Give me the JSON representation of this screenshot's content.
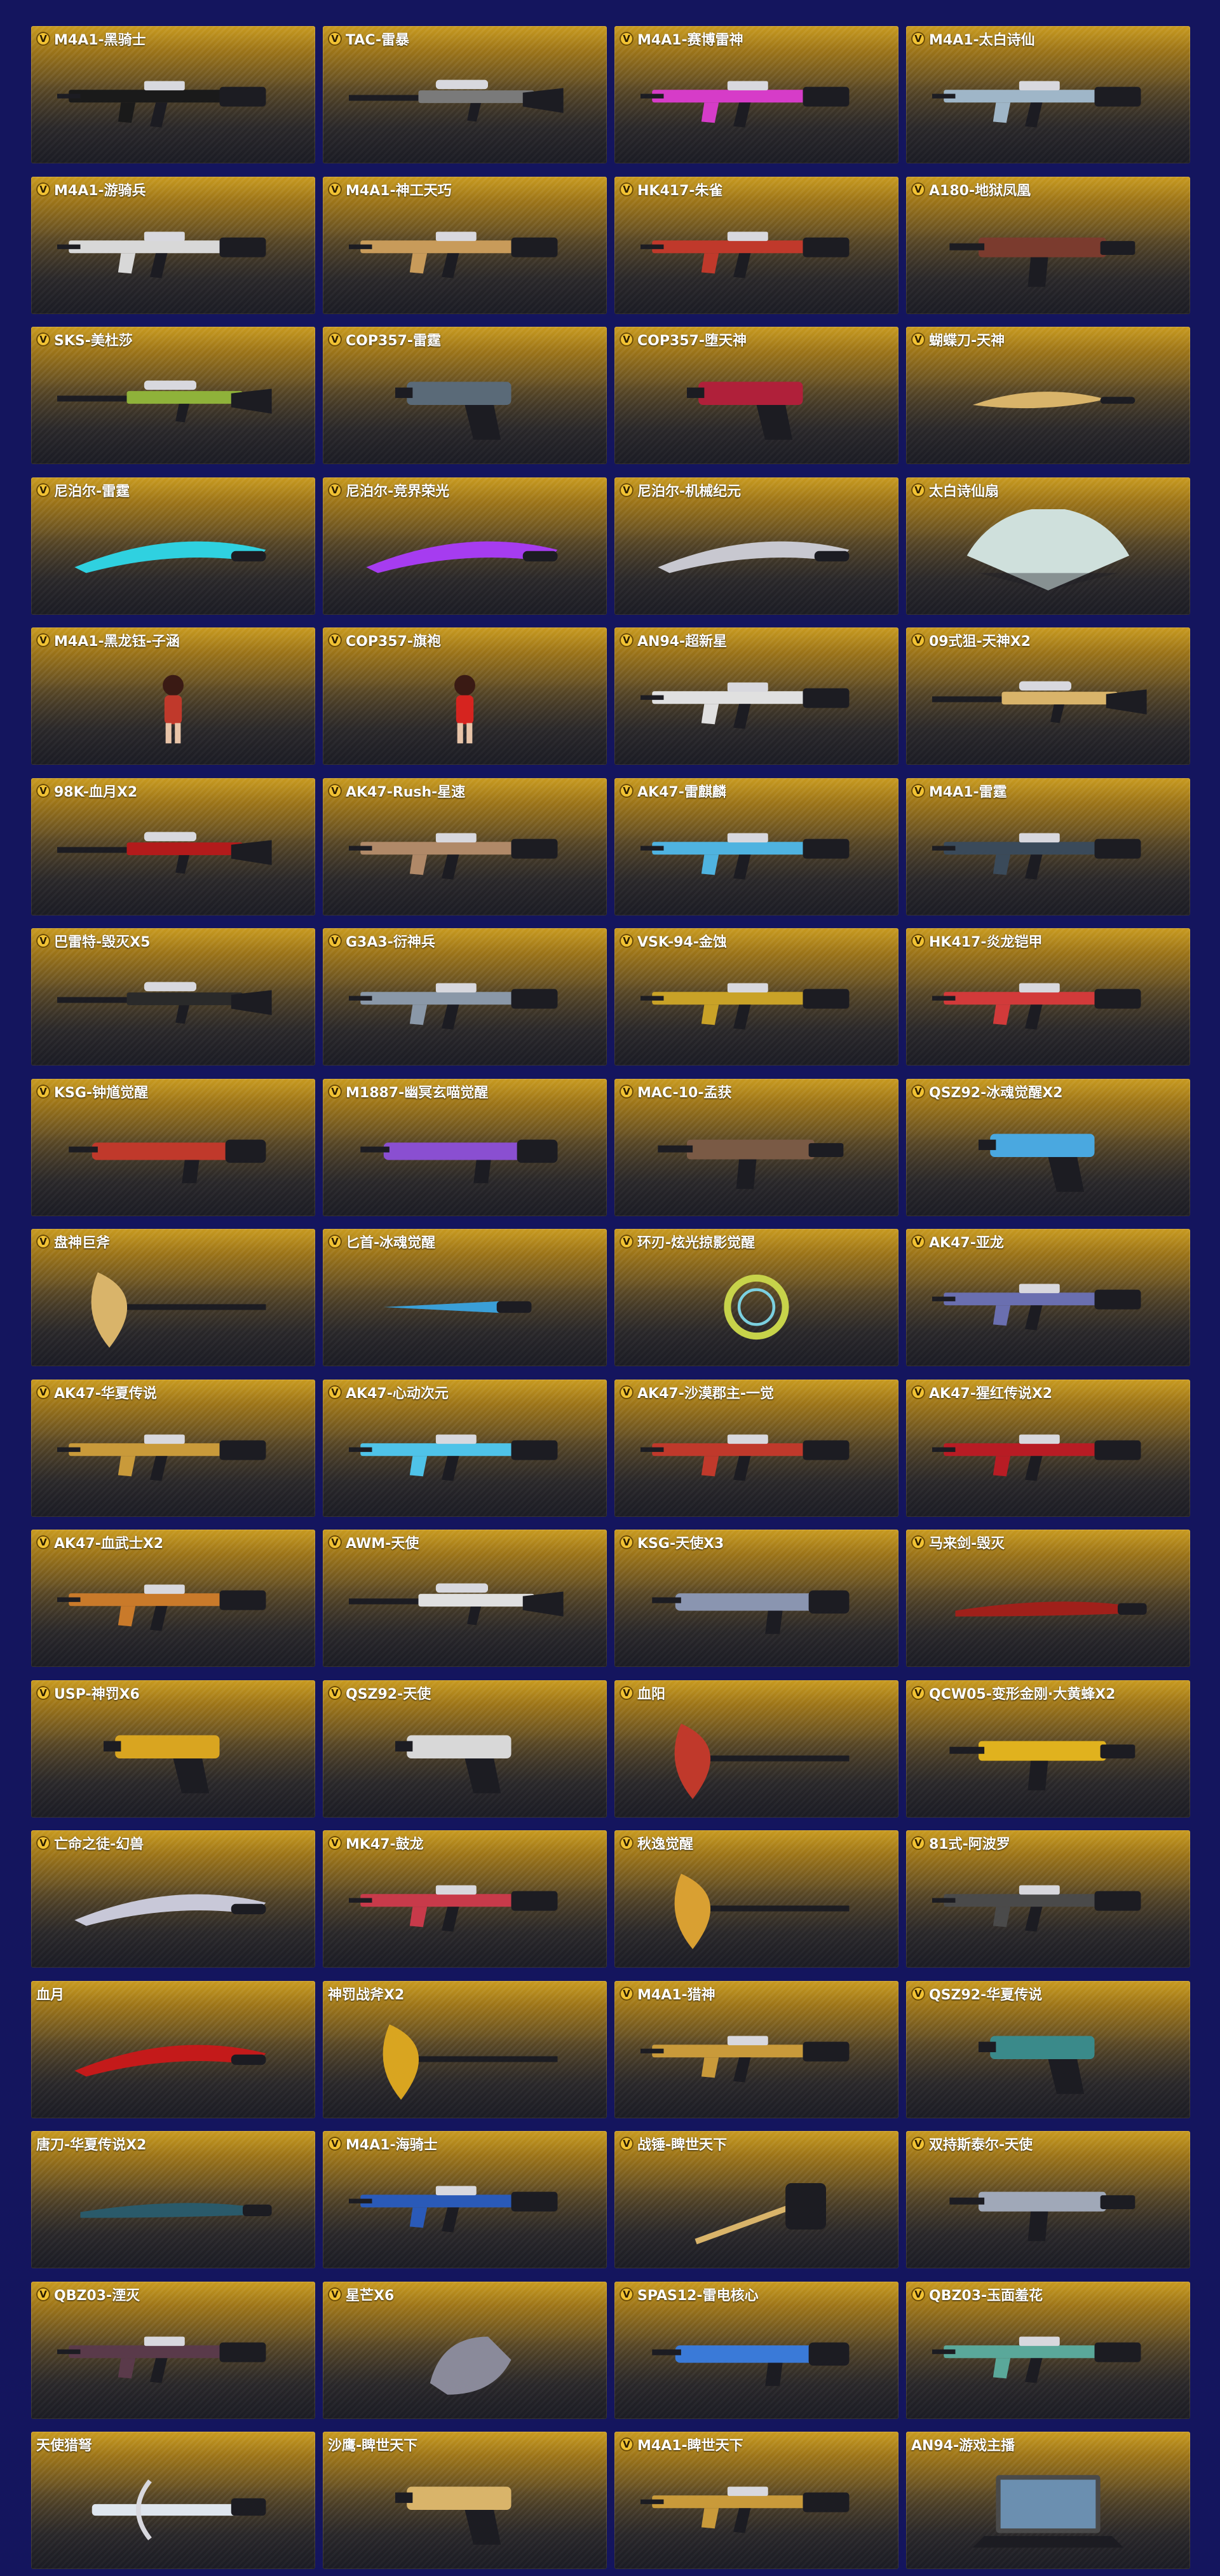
{
  "colors": {
    "background": "#14155e",
    "card_top": "#c89a1f",
    "card_bottom": "#25262e",
    "vip_badge": "#f1c233"
  },
  "items": [
    {
      "title": "M4A1-黑骑士",
      "vip": true,
      "icon": "rifle",
      "accent": "#1a1a1a"
    },
    {
      "title": "TAC-雷暴",
      "vip": true,
      "icon": "sniper",
      "accent": "#7a7a7a"
    },
    {
      "title": "M4A1-赛博雷神",
      "vip": true,
      "icon": "rifle",
      "accent": "#d63cc8"
    },
    {
      "title": "M4A1-太白诗仙",
      "vip": true,
      "icon": "rifle",
      "accent": "#9fb6c8"
    },
    {
      "title": "M4A1-游骑兵",
      "vip": true,
      "icon": "rifle",
      "accent": "#d8d8d8"
    },
    {
      "title": "M4A1-神工天巧",
      "vip": true,
      "icon": "rifle",
      "accent": "#c89b5a"
    },
    {
      "title": "HK417-朱雀",
      "vip": true,
      "icon": "rifle",
      "accent": "#c0392b"
    },
    {
      "title": "A180-地狱凤凰",
      "vip": true,
      "icon": "smg",
      "accent": "#7b3b2e"
    },
    {
      "title": "SKS-美杜莎",
      "vip": true,
      "icon": "sniper",
      "accent": "#8fb23a"
    },
    {
      "title": "COP357-雷霆",
      "vip": true,
      "icon": "pistol",
      "accent": "#5a6a78"
    },
    {
      "title": "COP357-堕天神",
      "vip": true,
      "icon": "pistol",
      "accent": "#b0203a"
    },
    {
      "title": "蝴蝶刀-天神",
      "vip": true,
      "icon": "knife",
      "accent": "#d9b46a"
    },
    {
      "title": "尼泊尔-雷霆",
      "vip": true,
      "icon": "blade",
      "accent": "#2fd1e0"
    },
    {
      "title": "尼泊尔-竞界荣光",
      "vip": true,
      "icon": "blade",
      "accent": "#a63cf0"
    },
    {
      "title": "尼泊尔-机械纪元",
      "vip": true,
      "icon": "blade",
      "accent": "#c8c8d0"
    },
    {
      "title": "太白诗仙扇",
      "vip": true,
      "icon": "fan",
      "accent": "#cfe0dc"
    },
    {
      "title": "M4A1-黑龙钰-子涵",
      "vip": true,
      "icon": "character",
      "accent": "#c0392b"
    },
    {
      "title": "COP357-旗袍",
      "vip": true,
      "icon": "character",
      "accent": "#d6241f"
    },
    {
      "title": "AN94-超新星",
      "vip": true,
      "icon": "rifle",
      "accent": "#e0e0e0"
    },
    {
      "title": "09式狙-天神X2",
      "vip": true,
      "icon": "sniper",
      "accent": "#d9b46a"
    },
    {
      "title": "98K-血月X2",
      "vip": true,
      "icon": "sniper",
      "accent": "#b31b1b"
    },
    {
      "title": "AK47-Rush-星速",
      "vip": true,
      "icon": "rifle",
      "accent": "#b08968"
    },
    {
      "title": "AK47-雷麒麟",
      "vip": true,
      "icon": "rifle",
      "accent": "#4fb3e0"
    },
    {
      "title": "M4A1-雷霆",
      "vip": true,
      "icon": "rifle",
      "accent": "#3a4a5a"
    },
    {
      "title": "巴雷特-毁灭X5",
      "vip": true,
      "icon": "sniper",
      "accent": "#2a2a2a"
    },
    {
      "title": "G3A3-衍神兵",
      "vip": true,
      "icon": "rifle",
      "accent": "#8a98a8"
    },
    {
      "title": "VSK-94-金蚀",
      "vip": true,
      "icon": "rifle",
      "accent": "#c9a227"
    },
    {
      "title": "HK417-炎龙铠甲",
      "vip": true,
      "icon": "rifle",
      "accent": "#d23a3a"
    },
    {
      "title": "KSG-钟馗觉醒",
      "vip": true,
      "icon": "shotgun",
      "accent": "#c0392b"
    },
    {
      "title": "M1887-幽冥玄喵觉醒",
      "vip": true,
      "icon": "shotgun",
      "accent": "#8a4fd1"
    },
    {
      "title": "MAC-10-孟获",
      "vip": true,
      "icon": "smg",
      "accent": "#7a5a45"
    },
    {
      "title": "QSZ92-冰魂觉醒X2",
      "vip": true,
      "icon": "pistol",
      "accent": "#4aa8e0"
    },
    {
      "title": "盘神巨斧",
      "vip": true,
      "icon": "axe",
      "accent": "#d9b46a"
    },
    {
      "title": "匕首-冰魂觉醒",
      "vip": true,
      "icon": "dagger",
      "accent": "#3a9fd8"
    },
    {
      "title": "环刃-炫光掠影觉醒",
      "vip": true,
      "icon": "ring",
      "accent": "#c7d34a"
    },
    {
      "title": "AK47-亚龙",
      "vip": true,
      "icon": "rifle",
      "accent": "#6a6fb0"
    },
    {
      "title": "AK47-华夏传说",
      "vip": true,
      "icon": "rifle",
      "accent": "#c99a3a"
    },
    {
      "title": "AK47-心动次元",
      "vip": true,
      "icon": "rifle",
      "accent": "#4fc3e8"
    },
    {
      "title": "AK47-沙漠郡主-一觉",
      "vip": true,
      "icon": "rifle",
      "accent": "#c0392b"
    },
    {
      "title": "AK47-猩红传说X2",
      "vip": true,
      "icon": "rifle",
      "accent": "#b81c24"
    },
    {
      "title": "AK47-血武士X2",
      "vip": true,
      "icon": "rifle",
      "accent": "#c97a2a"
    },
    {
      "title": "AWM-天使",
      "vip": true,
      "icon": "sniper",
      "accent": "#e0e0e0"
    },
    {
      "title": "KSG-天使X3",
      "vip": true,
      "icon": "shotgun",
      "accent": "#8a95b0"
    },
    {
      "title": "马来剑-毁灭",
      "vip": true,
      "icon": "sword",
      "accent": "#a0201a"
    },
    {
      "title": "USP-神罚X6",
      "vip": true,
      "icon": "pistol",
      "accent": "#d9a520"
    },
    {
      "title": "QSZ92-天使",
      "vip": true,
      "icon": "pistol",
      "accent": "#d8d8d8"
    },
    {
      "title": "血阳",
      "vip": true,
      "icon": "axe",
      "accent": "#c0392b"
    },
    {
      "title": "QCW05-变形金刚·大黄蜂X2",
      "vip": true,
      "icon": "smg",
      "accent": "#e0b21e"
    },
    {
      "title": "亡命之徒-幻兽",
      "vip": true,
      "icon": "blade",
      "accent": "#c8c8d8"
    },
    {
      "title": "MK47-鼓龙",
      "vip": true,
      "icon": "rifle",
      "accent": "#c83a4a"
    },
    {
      "title": "秋逸觉醒",
      "vip": true,
      "icon": "axe",
      "accent": "#d9a032"
    },
    {
      "title": "81式-阿波罗",
      "vip": true,
      "icon": "rifle",
      "accent": "#4a4a4a"
    },
    {
      "title": "血月",
      "vip": false,
      "icon": "blade",
      "accent": "#c41a1a"
    },
    {
      "title": "神罚战斧X2",
      "vip": false,
      "icon": "axe",
      "accent": "#d9a520"
    },
    {
      "title": "M4A1-猎神",
      "vip": true,
      "icon": "rifle",
      "accent": "#c99a3a"
    },
    {
      "title": "QSZ92-华夏传说",
      "vip": true,
      "icon": "pistol",
      "accent": "#3a8a8a"
    },
    {
      "title": "唐刀-华夏传说X2",
      "vip": false,
      "icon": "sword",
      "accent": "#2a5a6a"
    },
    {
      "title": "M4A1-海骑士",
      "vip": true,
      "icon": "rifle",
      "accent": "#2a5ab8"
    },
    {
      "title": "战锤-睥世天下",
      "vip": true,
      "icon": "hammer",
      "accent": "#d9b46a"
    },
    {
      "title": "双持斯泰尔-天使",
      "vip": true,
      "icon": "smg",
      "accent": "#a0a8b8"
    },
    {
      "title": "QBZ03-湮灭",
      "vip": true,
      "icon": "rifle",
      "accent": "#5a3a4a"
    },
    {
      "title": "星芒X6",
      "vip": true,
      "icon": "gauntlet",
      "accent": "#8a8a9a"
    },
    {
      "title": "SPAS12-雷电核心",
      "vip": true,
      "icon": "shotgun",
      "accent": "#3a7ad8"
    },
    {
      "title": "QBZ03-玉面羞花",
      "vip": true,
      "icon": "rifle",
      "accent": "#5aa89a"
    },
    {
      "title": "天使猎弩",
      "vip": false,
      "icon": "crossbow",
      "accent": "#dfe6ee"
    },
    {
      "title": "沙鹰-睥世天下",
      "vip": false,
      "icon": "pistol",
      "accent": "#d9b46a"
    },
    {
      "title": "M4A1-睥世天下",
      "vip": true,
      "icon": "rifle",
      "accent": "#c99a3a"
    },
    {
      "title": "AN94-游戏主播",
      "vip": false,
      "icon": "laptop",
      "accent": "#4a4a4a"
    }
  ]
}
